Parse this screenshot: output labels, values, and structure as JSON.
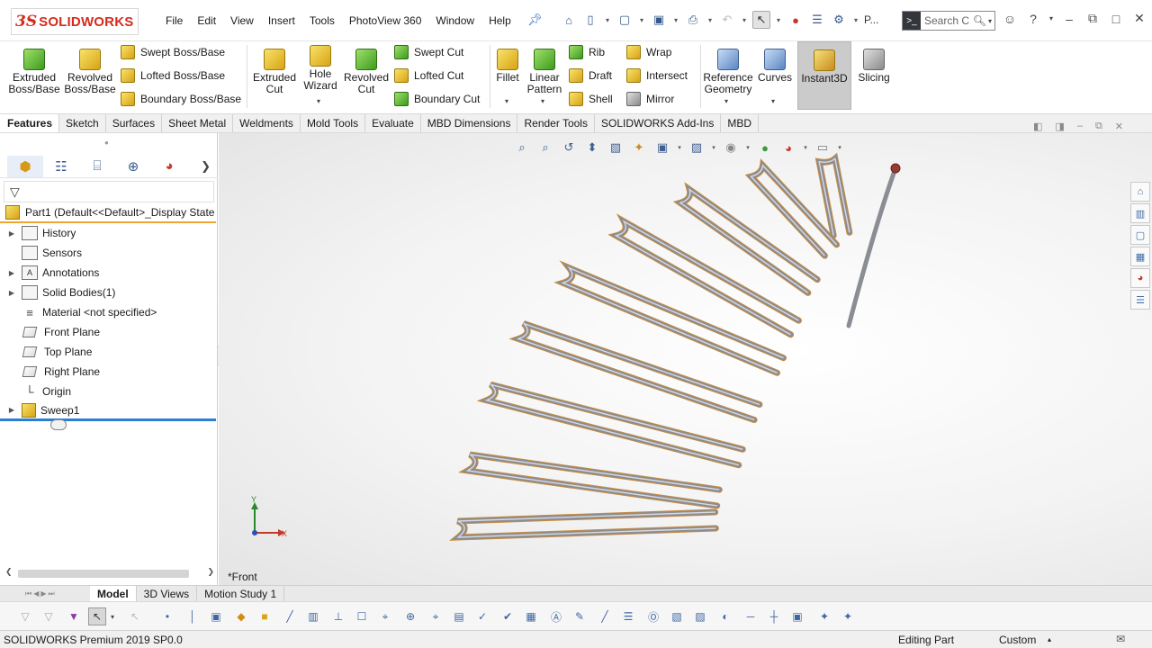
{
  "app": {
    "logo_mark": "3S",
    "logo_text": "SOLIDWORKS"
  },
  "menu": [
    "File",
    "Edit",
    "View",
    "Insert",
    "Tools",
    "PhotoView 360",
    "Window",
    "Help"
  ],
  "toolbar": {
    "profile_label": "P...",
    "search_placeholder": "Search C"
  },
  "ribbon": {
    "extruded_boss": "Extruded Boss/Base",
    "revolved_boss": "Revolved Boss/Base",
    "swept_boss": "Swept Boss/Base",
    "lofted_boss": "Lofted Boss/Base",
    "boundary_boss": "Boundary Boss/Base",
    "extruded_cut": "Extruded Cut",
    "hole_wizard": "Hole Wizard",
    "revolved_cut": "Revolved Cut",
    "swept_cut": "Swept Cut",
    "lofted_cut": "Lofted Cut",
    "boundary_cut": "Boundary Cut",
    "fillet": "Fillet",
    "linear_pattern": "Linear Pattern",
    "rib": "Rib",
    "draft": "Draft",
    "shell": "Shell",
    "wrap": "Wrap",
    "intersect": "Intersect",
    "mirror": "Mirror",
    "reference_geometry": "Reference Geometry",
    "curves": "Curves",
    "instant3d": "Instant3D",
    "slicing": "Slicing"
  },
  "tabs": [
    "Features",
    "Sketch",
    "Surfaces",
    "Sheet Metal",
    "Weldments",
    "Mold Tools",
    "Evaluate",
    "MBD Dimensions",
    "Render Tools",
    "SOLIDWORKS Add-Ins",
    "MBD"
  ],
  "feature_tree": {
    "root": "Part1  (Default<<Default>_Display State",
    "items": [
      {
        "label": "History"
      },
      {
        "label": "Sensors"
      },
      {
        "label": "Annotations"
      },
      {
        "label": "Solid Bodies(1)"
      },
      {
        "label": "Material <not specified>"
      },
      {
        "label": "Front Plane"
      },
      {
        "label": "Top Plane"
      },
      {
        "label": "Right Plane"
      },
      {
        "label": "Origin"
      },
      {
        "label": "Sweep1"
      }
    ]
  },
  "viewport": {
    "view_name": "*Front",
    "triad_x": "X",
    "triad_y": "Y"
  },
  "model_tabs": [
    "Model",
    "3D Views",
    "Motion Study 1"
  ],
  "status": {
    "product": "SOLIDWORKS Premium 2019 SP0.0",
    "mode": "Editing Part",
    "units": "Custom"
  },
  "colors": {
    "brand": "#d52b1e",
    "tree_root_underline": "#f0a530",
    "tree_last_underline": "#2a7fd4",
    "spring_body": "#8a8d94",
    "spring_edge": "#c98a3a"
  },
  "icons": {
    "menu_pin": "pin-icon",
    "search": "magnifier-icon",
    "user": "user-icon",
    "help": "question-icon"
  }
}
